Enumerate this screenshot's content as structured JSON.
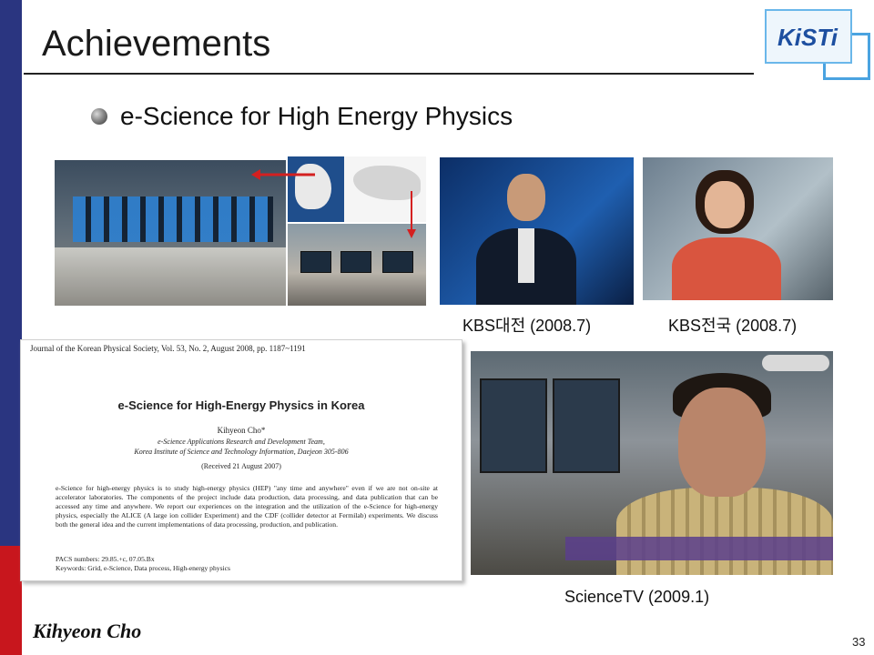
{
  "slide": {
    "title": "Achievements",
    "logo_text": "KiSTi",
    "bullet": "e-Science for High Energy Physics",
    "captions": {
      "kbs_daejeon": "KBS대전 (2008.7)",
      "kbs_national": "KBS전국 (2008.7)",
      "sciencetv": "ScienceTV (2009.1)"
    },
    "paper": {
      "journal_line": "Journal of the Korean Physical Society, Vol. 53, No. 2, August 2008, pp. 1187~1191",
      "title": "e-Science for High-Energy Physics in Korea",
      "author": "Kihyeon Cho*",
      "affiliation": "e-Science Applications Research and Development Team,\nKorea Institute of Science and Technology Information, Daejeon 305-806",
      "received": "(Received 21 August 2007)",
      "abstract": "e-Science for high-energy physics is to study high-energy physics (HEP) \"any time and anywhere\" even if we are not on-site at accelerator laboratories. The components of the project include data production, data processing, and data publication that can be accessed any time and anywhere. We report our experiences on the integration and the utilization of the e-Science for high-energy physics, especially the ALICE (A large ion collider Experiment) and the CDF (collider detector at Fermilab) experiments. We discuss both the general idea and the current implementations of data processing, production, and publication.",
      "pacs": "PACS numbers: 29.85.+c, 07.05.Bx\nKeywords: Grid, e-Science, Data process, High-energy physics"
    },
    "footer_name": "Kihyeon Cho",
    "page_number": "33"
  },
  "colors": {
    "left_bar_blue": "#2a3580",
    "left_bar_red": "#c8161d",
    "logo_blue": "#1d4fa0"
  }
}
